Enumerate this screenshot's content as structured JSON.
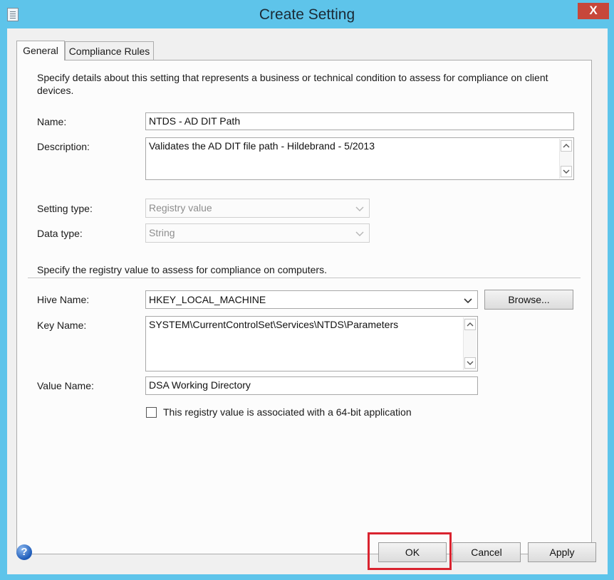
{
  "window": {
    "title": "Create Setting",
    "close_glyph": "X",
    "icon": "document-icon"
  },
  "tabs": [
    {
      "label": "General",
      "active": true
    },
    {
      "label": "Compliance Rules",
      "active": false
    }
  ],
  "general": {
    "intro": "Specify details about this setting that represents a business or technical condition to assess for compliance on client devices.",
    "name_label": "Name:",
    "name_value": "NTDS - AD DIT Path",
    "description_label": "Description:",
    "description_value": "Validates the AD DIT file path - Hildebrand - 5/2013",
    "setting_type_label": "Setting type:",
    "setting_type_value": "Registry value",
    "data_type_label": "Data type:",
    "data_type_value": "String",
    "registry_intro": "Specify the registry value to assess for compliance on computers.",
    "hive_label": "Hive Name:",
    "hive_value": "HKEY_LOCAL_MACHINE",
    "browse_label": "Browse...",
    "key_label": "Key Name:",
    "key_value": "SYSTEM\\CurrentControlSet\\Services\\NTDS\\Parameters",
    "value_name_label": "Value Name:",
    "value_name_value": "DSA Working Directory",
    "checkbox_label": "This registry value is associated with a 64-bit application",
    "checkbox_checked": false
  },
  "footer": {
    "help_glyph": "?",
    "ok_label": "OK",
    "cancel_label": "Cancel",
    "apply_label": "Apply"
  },
  "colors": {
    "frame": "#5ec4ea",
    "close": "#c7473a",
    "highlight": "#d9232f"
  }
}
